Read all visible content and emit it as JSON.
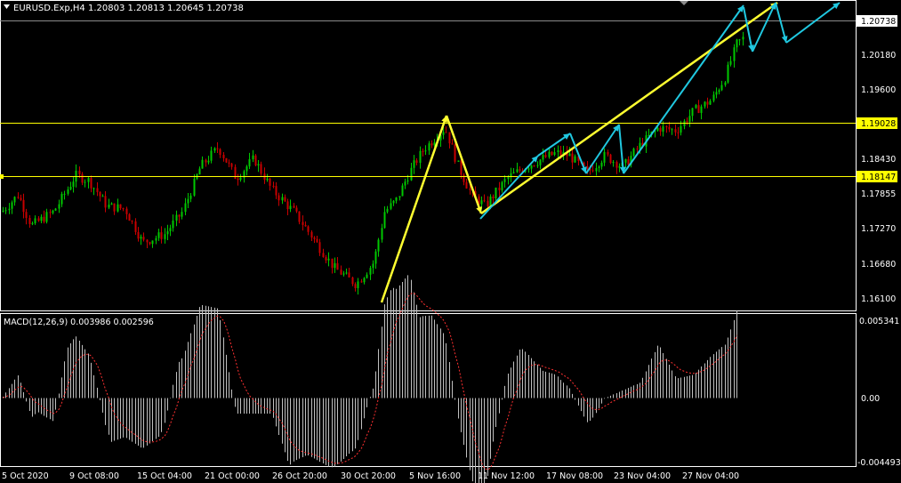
{
  "header": {
    "symbol_line": "EURUSD.Exp,H4  1.20803 1.20813 1.20645 1.20738"
  },
  "indicator": {
    "title": "MACD(12,26,9) 0.003986 0.002596",
    "scale_top": "0.005341",
    "scale_zero": "0.00",
    "scale_bottom": "-0.004493"
  },
  "price_axis": {
    "labels": [
      "1.20180",
      "1.19600",
      "1.18430",
      "1.17855",
      "1.17270",
      "1.16680",
      "1.16100"
    ],
    "current_price": "1.20738",
    "hline_1": "1.19028",
    "hline_2": "1.18147"
  },
  "time_axis": {
    "labels": [
      "5 Oct 2020",
      "9 Oct 08:00",
      "15 Oct 04:00",
      "21 Oct 00:00",
      "26 Oct 20:00",
      "30 Oct 20:00",
      "5 Nov 16:00",
      "11 Nov 12:00",
      "17 Nov 08:00",
      "23 Nov 04:00",
      "27 Nov 04:00"
    ]
  },
  "colors": {
    "background": "#000000",
    "bull_candle": "#00c800",
    "bear_candle": "#c80000",
    "hline": "#ffff00",
    "wave_major": "#ffff30",
    "wave_minor": "#20c8e0",
    "macd_hist": "#c0c0c0",
    "macd_signal": "#ff3030",
    "grid_border": "#ffffff"
  },
  "chart_data": {
    "type": "candlestick",
    "symbol": "EURUSD.Exp",
    "timeframe": "H4",
    "price_range": [
      1.1585,
      1.2135
    ],
    "price_path": [
      [
        "5 Oct 2020",
        1.176
      ],
      [
        "9 Oct 08:00",
        1.183
      ],
      [
        "15 Oct 04:00",
        1.171
      ],
      [
        "21 Oct 00:00",
        1.187
      ],
      [
        "26 Oct 20:00",
        1.176
      ],
      [
        "30 Oct 20:00",
        1.164
      ],
      [
        "5 Nov 16:00",
        1.191
      ],
      [
        "11 Nov 12:00",
        1.1795
      ],
      [
        "17 Nov 08:00",
        1.186
      ],
      [
        "23 Nov 04:00",
        1.188
      ],
      [
        "27 Nov 04:00",
        1.196
      ],
      [
        "latest",
        1.2074
      ]
    ],
    "horizontal_levels": [
      1.19028,
      1.18147
    ],
    "macd": {
      "params": "12,26,9",
      "main": 0.003986,
      "signal": 0.002596,
      "range": [
        -0.004493,
        0.005341
      ]
    }
  }
}
